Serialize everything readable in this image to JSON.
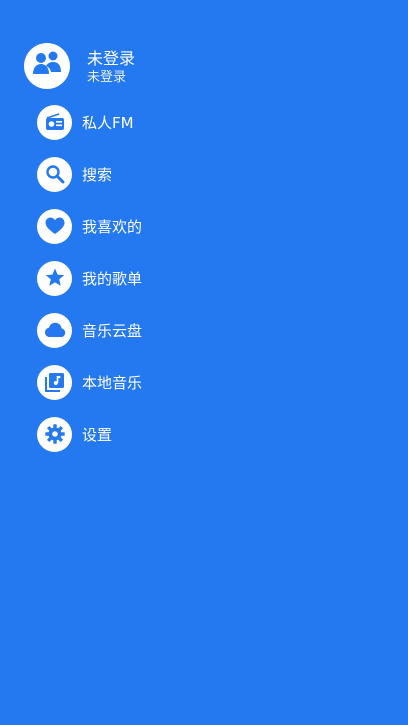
{
  "theme": {
    "background": "#2478f0",
    "icon_fg": "#2478f0",
    "icon_bg": "#ffffff",
    "text": "#ffffff"
  },
  "profile": {
    "name": "未登录",
    "status": "未登录",
    "avatar_icon": "users-icon"
  },
  "menu": [
    {
      "id": "fm",
      "label": "私人FM",
      "icon": "radio-icon"
    },
    {
      "id": "search",
      "label": "搜索",
      "icon": "search-icon"
    },
    {
      "id": "favorites",
      "label": "我喜欢的",
      "icon": "heart-icon"
    },
    {
      "id": "playlists",
      "label": "我的歌单",
      "icon": "star-icon"
    },
    {
      "id": "cloud",
      "label": "音乐云盘",
      "icon": "cloud-icon"
    },
    {
      "id": "local",
      "label": "本地音乐",
      "icon": "music-library-icon"
    },
    {
      "id": "settings",
      "label": "设置",
      "icon": "gear-icon"
    }
  ]
}
